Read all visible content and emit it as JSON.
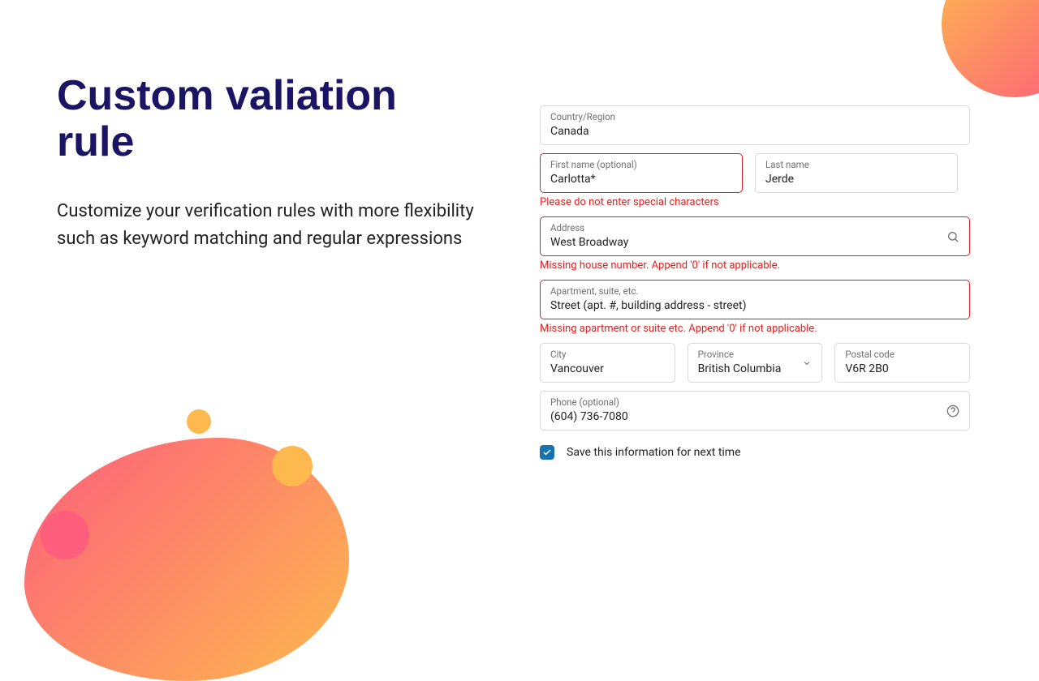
{
  "heading": {
    "title": "Custom valiation rule",
    "subtitle": "Customize your verification rules with more flexibility such as keyword matching and regular expressions"
  },
  "form": {
    "country": {
      "label": "Country/Region",
      "value": "Canada"
    },
    "firstName": {
      "label": "First name (optional)",
      "value": "Carlotta*",
      "error": "Please do not enter special characters"
    },
    "lastName": {
      "label": "Last name",
      "value": "Jerde"
    },
    "address": {
      "label": "Address",
      "value": "West Broadway",
      "error": "Missing house number. Append '0' if not applicable."
    },
    "apartment": {
      "label": "Apartment, suite, etc.",
      "value": "Street (apt. #, building address - street)",
      "error": "Missing apartment or suite etc. Append '0' if not applicable."
    },
    "city": {
      "label": "City",
      "value": "Vancouver"
    },
    "province": {
      "label": "Province",
      "value": "British Columbia"
    },
    "postal": {
      "label": "Postal code",
      "value": "V6R 2B0"
    },
    "phone": {
      "label": "Phone (optional)",
      "value": "(604) 736-7080"
    },
    "saveInfo": {
      "label": "Save this information for next time",
      "checked": true
    }
  }
}
